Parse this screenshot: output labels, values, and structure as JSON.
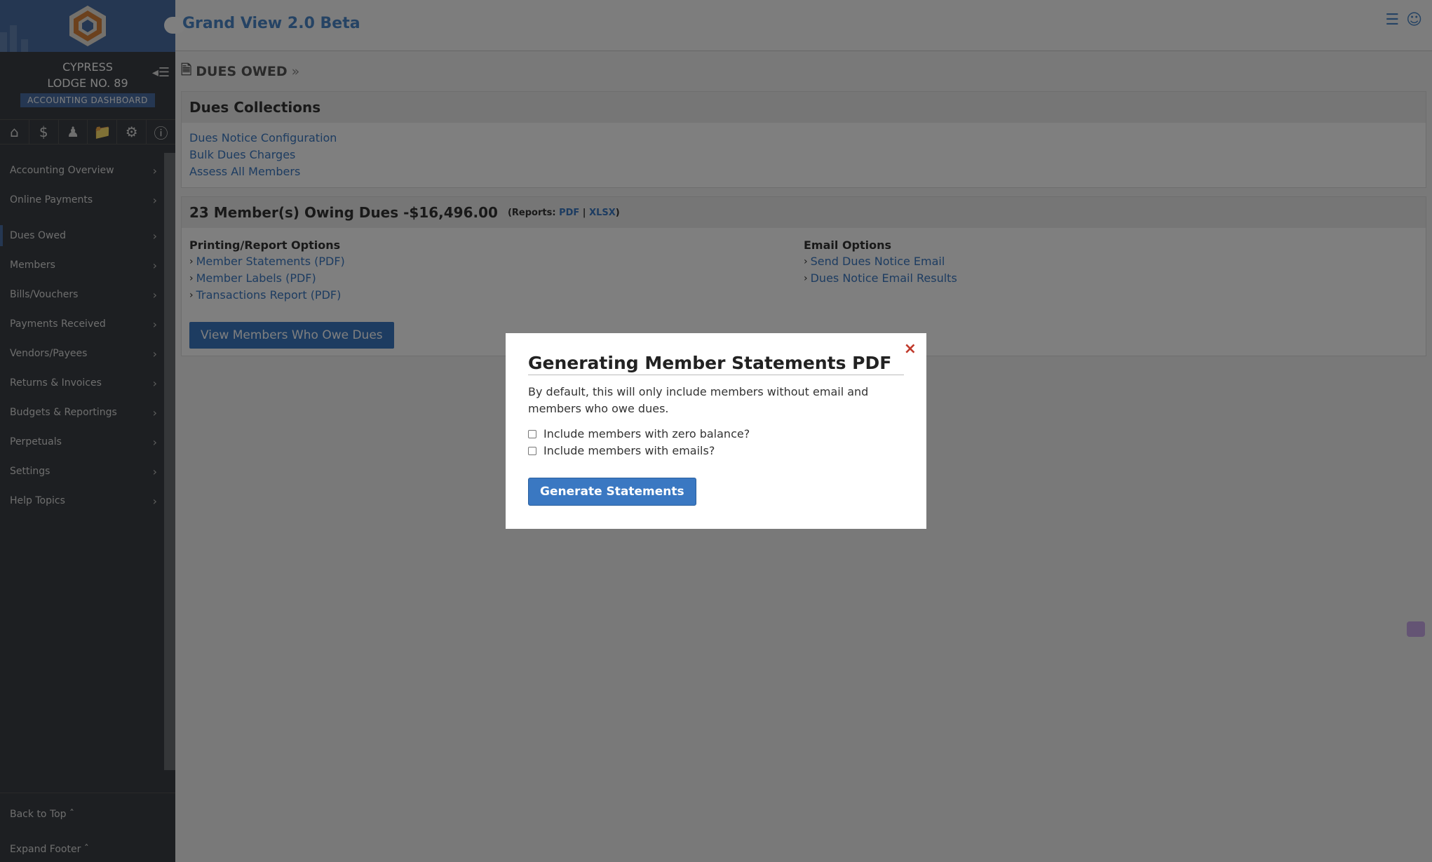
{
  "app": {
    "title": "Grand View 2.0 Beta",
    "lodge_line1": "CYPRESS",
    "lodge_line2": "LODGE NO. 89",
    "dashboard_badge": "ACCOUNTING DASHBOARD"
  },
  "sidebar": {
    "items": [
      {
        "label": "Accounting Overview"
      },
      {
        "label": "Online Payments"
      },
      {
        "label": "Dues Owed"
      },
      {
        "label": "Members"
      },
      {
        "label": "Bills/Vouchers"
      },
      {
        "label": "Payments Received"
      },
      {
        "label": "Vendors/Payees"
      },
      {
        "label": "Returns & Invoices"
      },
      {
        "label": "Budgets & Reportings"
      },
      {
        "label": "Perpetuals"
      },
      {
        "label": "Settings"
      },
      {
        "label": "Help Topics"
      }
    ],
    "back_to_top": "Back to Top",
    "expand_footer": "Expand Footer"
  },
  "page": {
    "title": "DUES OWED"
  },
  "dues_collections": {
    "heading": "Dues Collections",
    "links": [
      "Dues Notice Configuration",
      "Bulk Dues Charges",
      "Assess All Members"
    ]
  },
  "owing": {
    "heading": "23 Member(s) Owing Dues -$16,496.00",
    "reports_label": "(Reports:",
    "pdf": "PDF",
    "sep": "|",
    "xlsx": "XLSX",
    "close_paren": ")",
    "printing_heading": "Printing/Report Options",
    "printing_links": [
      "Member Statements (PDF)",
      "Member Labels (PDF)",
      "Transactions Report (PDF)"
    ],
    "email_heading": "Email Options",
    "email_links": [
      "Send Dues Notice Email",
      "Dues Notice Email Results"
    ],
    "view_button": "View Members Who Owe Dues"
  },
  "modal": {
    "title": "Generating Member Statements PDF",
    "description": "By default, this will only include members without email and members who owe dues.",
    "option_zero_balance": "Include members with zero balance?",
    "option_emails": "Include members with emails?",
    "generate_button": "Generate Statements",
    "close": "×"
  }
}
